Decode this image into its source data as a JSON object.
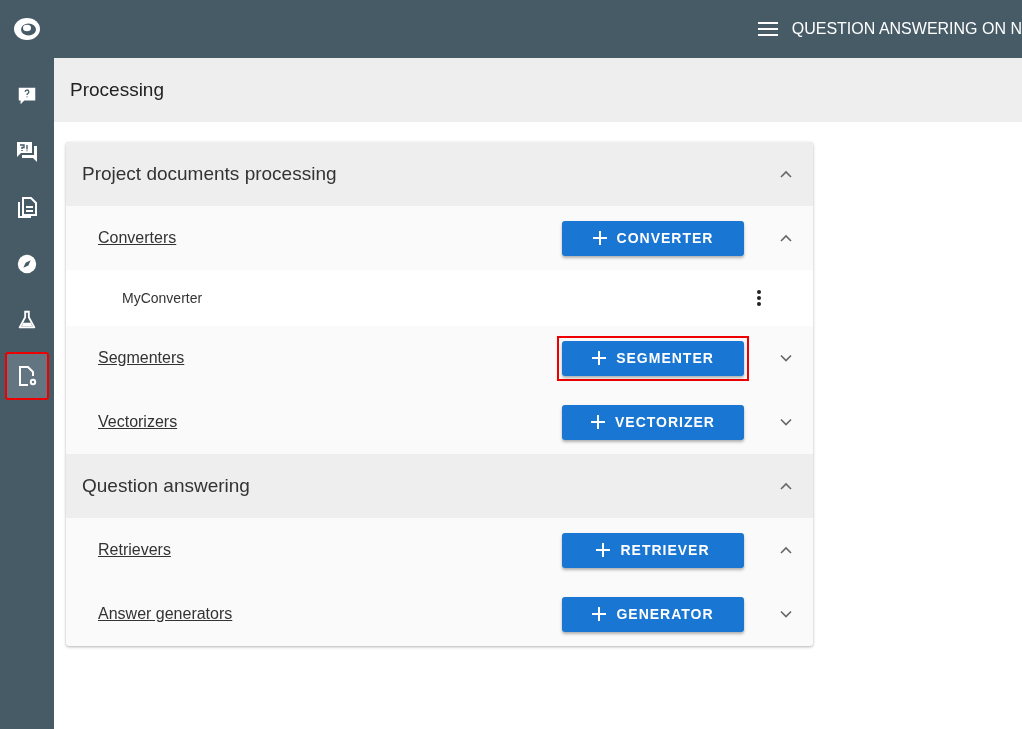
{
  "app_bar": {
    "title": "QUESTION ANSWERING ON N"
  },
  "sidebar": {
    "items": [
      {
        "selected": false,
        "highlighted": false
      },
      {
        "selected": false,
        "highlighted": false
      },
      {
        "selected": false,
        "highlighted": false
      },
      {
        "selected": false,
        "highlighted": false
      },
      {
        "selected": false,
        "highlighted": false
      },
      {
        "selected": true,
        "highlighted": true
      }
    ]
  },
  "page": {
    "title": "Processing"
  },
  "sections": [
    {
      "title": "Project documents processing",
      "expanded": true,
      "groups": [
        {
          "label": "Converters",
          "button": "CONVERTER",
          "expanded": true,
          "highlighted": false,
          "items": [
            {
              "name": "MyConverter"
            }
          ]
        },
        {
          "label": "Segmenters",
          "button": "SEGMENTER",
          "expanded": false,
          "highlighted": true
        },
        {
          "label": "Vectorizers",
          "button": "VECTORIZER",
          "expanded": false,
          "highlighted": false
        }
      ]
    },
    {
      "title": "Question answering",
      "expanded": true,
      "groups": [
        {
          "label": "Retrievers",
          "button": "RETRIEVER",
          "expanded": true,
          "highlighted": false
        },
        {
          "label": "Answer generators",
          "button": "GENERATOR",
          "expanded": false,
          "highlighted": false
        }
      ]
    }
  ]
}
